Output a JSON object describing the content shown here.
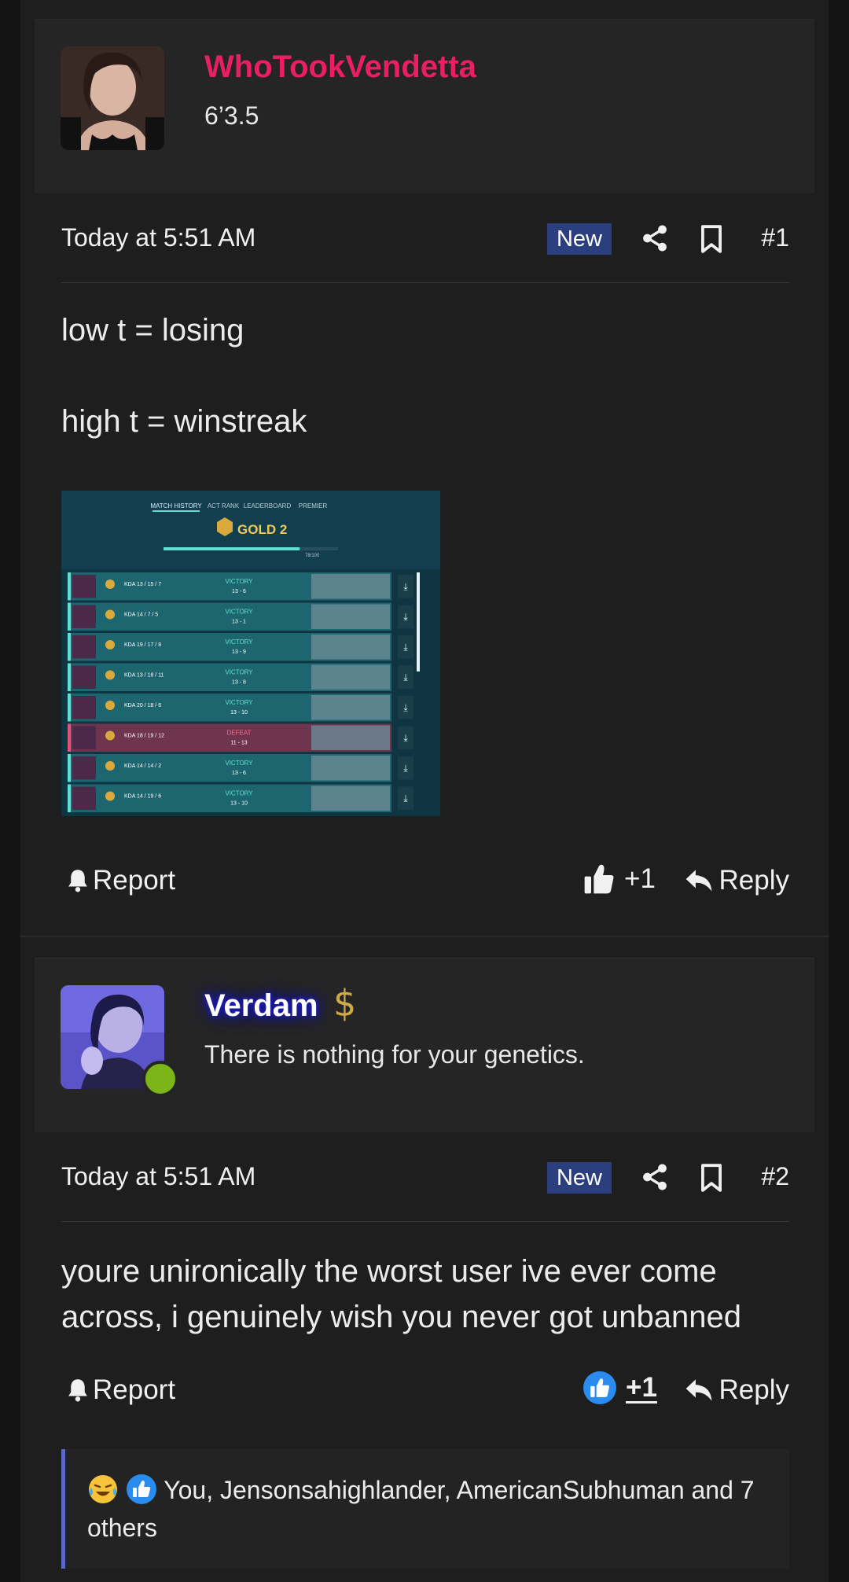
{
  "posts": [
    {
      "username": "WhoTookVendetta",
      "user_title": "6’3.5",
      "date": "Today at 5:51 AM",
      "badge": "New",
      "number": "#1",
      "lines": [
        "low t = losing",
        "high t = winstreak"
      ],
      "attachment": {
        "tabs": [
          "MATCH HISTORY",
          "ACT RANK",
          "LEADERBOARD",
          "PREMIER"
        ],
        "rank": "GOLD 2",
        "rank_rating": "78/100",
        "matches": [
          {
            "kda": "KDA 13 / 15 / 7",
            "result": "VICTORY",
            "score": "13 - 6"
          },
          {
            "kda": "KDA 14 / 7 / 5",
            "result": "VICTORY",
            "score": "13 - 1"
          },
          {
            "kda": "KDA 19 / 17 / 8",
            "result": "VICTORY",
            "score": "13 - 9"
          },
          {
            "kda": "KDA 13 / 18 / 11",
            "result": "VICTORY",
            "score": "13 - 8"
          },
          {
            "kda": "KDA 20 / 18 / 6",
            "result": "VICTORY",
            "score": "13 - 10"
          },
          {
            "kda": "KDA 18 / 19 / 12",
            "result": "DEFEAT",
            "score": "11 - 13"
          },
          {
            "kda": "KDA 14 / 14 / 2",
            "result": "VICTORY",
            "score": "13 - 6"
          },
          {
            "kda": "KDA 14 / 19 / 6",
            "result": "VICTORY",
            "score": "13 - 10"
          }
        ]
      },
      "report_label": "Report",
      "like_count": "+1",
      "reply_label": "Reply"
    },
    {
      "username": "Verdam",
      "user_title": "There is nothing for your genetics.",
      "date": "Today at 5:51 AM",
      "badge": "New",
      "number": "#2",
      "text": "youre unironically the worst user ive ever come across, i genuinely wish you never got unbanned",
      "report_label": "Report",
      "like_count": "+1",
      "reply_label": "Reply",
      "reactions_text": "You, Jensonsahighlander, AmericanSubhuman and 7 others"
    }
  ],
  "icons": {
    "share": "share-icon",
    "bookmark": "bookmark-icon",
    "bell": "bell-icon",
    "thumb": "thumbs-up-icon",
    "reply": "reply-arrow-icon",
    "dollar": "dollar-sign-icon"
  },
  "colors": {
    "username1": "#ea1e63",
    "badge_bg": "#2b3f7f",
    "like_blue": "#2a8cef",
    "online": "#7cb518",
    "reaction_bar": "#5c68c8"
  }
}
